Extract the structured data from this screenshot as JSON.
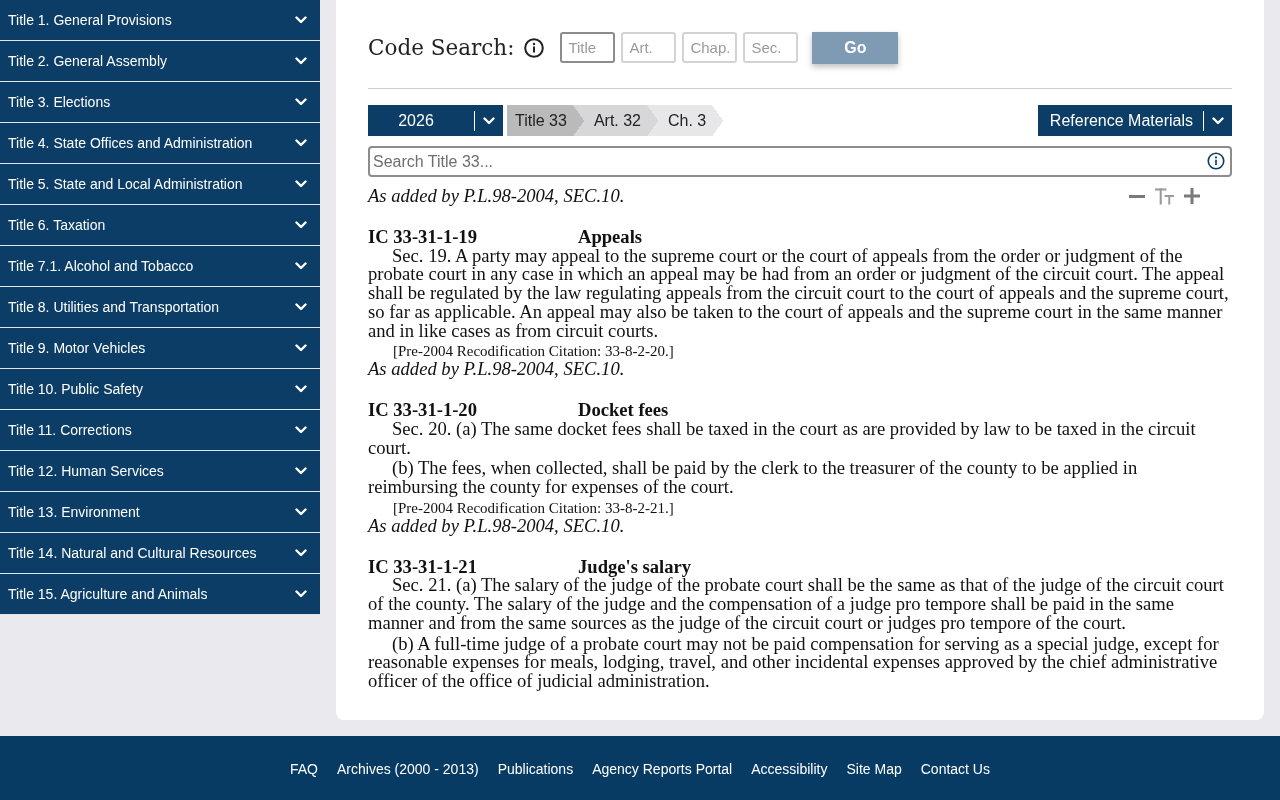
{
  "sidebar": {
    "items": [
      {
        "label": "Title 1. General Provisions"
      },
      {
        "label": "Title 2. General Assembly"
      },
      {
        "label": "Title 3. Elections"
      },
      {
        "label": "Title 4. State Offices and Administration"
      },
      {
        "label": "Title 5. State and Local Administration"
      },
      {
        "label": "Title 6. Taxation"
      },
      {
        "label": "Title 7.1. Alcohol and Tobacco"
      },
      {
        "label": "Title 8. Utilities and Transportation"
      },
      {
        "label": "Title 9. Motor Vehicles"
      },
      {
        "label": "Title 10. Public Safety"
      },
      {
        "label": "Title 11. Corrections"
      },
      {
        "label": "Title 12. Human Services"
      },
      {
        "label": "Title 13. Environment"
      },
      {
        "label": "Title 14. Natural and Cultural Resources"
      },
      {
        "label": "Title 15. Agriculture and Animals"
      }
    ]
  },
  "code_search": {
    "label": "Code Search:",
    "fields": [
      {
        "placeholder": "Title",
        "focused": true
      },
      {
        "placeholder": "Art.",
        "focused": false
      },
      {
        "placeholder": "Chap.",
        "focused": false
      },
      {
        "placeholder": "Sec.",
        "focused": false
      }
    ],
    "go_button": {
      "label": "Go",
      "disabled": true
    }
  },
  "navigation": {
    "year_dropdown": "2026",
    "breadcrumbs": [
      "Title 33",
      "Art. 32",
      "Ch. 3"
    ],
    "reference_dropdown": "Reference Materials"
  },
  "search": {
    "placeholder": "Search Title 33..."
  },
  "content": {
    "leading_history_note": "As added by P.L.98-2004, SEC.10.",
    "sections": [
      {
        "number": "IC 33-31-1-19",
        "heading": "Appeals",
        "paragraphs": [
          "Sec. 19. A party may appeal to the supreme court or the court of appeals from the order or judgment of the probate court in any case in which an appeal may be had from an order or judgment of the circuit court. The appeal shall be regulated by the law regulating appeals from the circuit court to the court of appeals and the supreme court, so far as applicable. An appeal may also be taken to the court of appeals and the supreme court in the same manner and in like cases as from circuit courts."
        ],
        "citation": "[Pre-2004 Recodification Citation: 33-8-2-20.]",
        "history": "As added by P.L.98-2004, SEC.10."
      },
      {
        "number": "IC 33-31-1-20",
        "heading": "Docket fees",
        "paragraphs": [
          "Sec. 20. (a) The same docket fees shall be taxed in the court as are provided by law to be taxed in the circuit court.",
          "(b) The fees, when collected, shall be paid by the clerk to the treasurer of the county to be applied in reimbursing the county for expenses of the court."
        ],
        "citation": "[Pre-2004 Recodification Citation: 33-8-2-21.]",
        "history": "As added by P.L.98-2004, SEC.10."
      },
      {
        "number": "IC 33-31-1-21",
        "heading": "Judge's salary",
        "paragraphs": [
          "Sec. 21. (a) The salary of the judge of the probate court shall be the same as that of the judge of the circuit court of the county. The salary of the judge and the compensation of a judge pro tempore shall be paid in the same manner and from the same sources as the judge of the circuit court or judges pro tempore of the court.",
          "(b) A full-time judge of a probate court may not be paid compensation for serving as a special judge, except for reasonable expenses for meals, lodging, travel, and other incidental expenses approved by the chief administrative officer of the office of judicial administration."
        ]
      }
    ]
  },
  "footer": {
    "links": [
      "FAQ",
      "Archives (2000 - 2013)",
      "Publications",
      "Agency Reports Portal",
      "Accessibility",
      "Site Map",
      "Contact Us"
    ]
  }
}
